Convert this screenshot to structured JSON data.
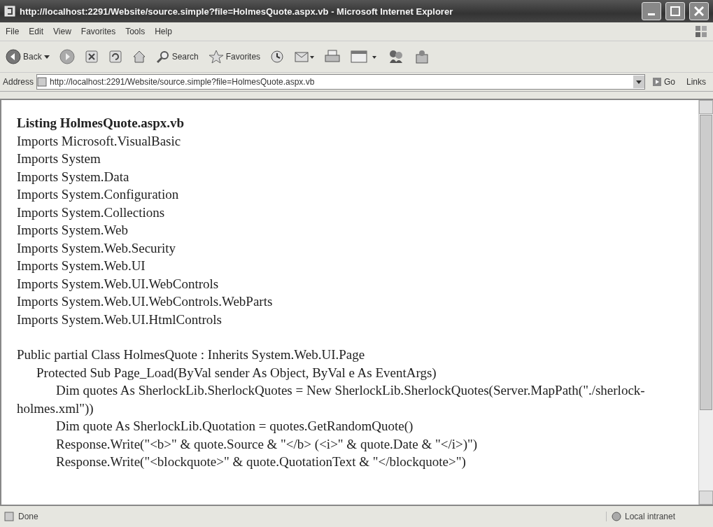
{
  "window": {
    "title": "http://localhost:2291/Website/source.simple?file=HolmesQuote.aspx.vb - Microsoft Internet Explorer"
  },
  "menu": [
    "File",
    "Edit",
    "View",
    "Favorites",
    "Tools",
    "Help"
  ],
  "toolbar": [
    {
      "kind": "back",
      "label": "Back"
    },
    {
      "kind": "forward"
    },
    {
      "kind": "stop"
    },
    {
      "kind": "refresh"
    },
    {
      "kind": "home"
    },
    {
      "kind": "search",
      "label": "Search"
    },
    {
      "kind": "favorites",
      "label": "Favorites"
    },
    {
      "kind": "history"
    },
    {
      "kind": "mail"
    },
    {
      "kind": "print"
    },
    {
      "kind": "edit"
    },
    {
      "kind": "messenger"
    },
    {
      "kind": "research"
    }
  ],
  "address_bar": {
    "label": "Address",
    "value": "http://localhost:2291/Website/source.simple?file=HolmesQuote.aspx.vb",
    "go": "Go",
    "links": "Links"
  },
  "page": {
    "heading": "Listing HolmesQuote.aspx.vb",
    "lines": [
      {
        "text": "Imports Microsoft.VisualBasic"
      },
      {
        "text": "Imports System"
      },
      {
        "text": "Imports System.Data"
      },
      {
        "text": "Imports System.Configuration"
      },
      {
        "text": "Imports System.Collections"
      },
      {
        "text": "Imports System.Web"
      },
      {
        "text": "Imports System.Web.Security"
      },
      {
        "text": "Imports System.Web.UI"
      },
      {
        "text": "Imports System.Web.UI.WebControls"
      },
      {
        "text": "Imports System.Web.UI.WebControls.WebParts"
      },
      {
        "text": "Imports System.Web.UI.HtmlControls"
      },
      {
        "text": "Public partial Class HolmesQuote : Inherits System.Web.UI.Page",
        "children": [
          {
            "text": "Protected Sub Page_Load(ByVal sender As Object, ByVal e As EventArgs)",
            "children": [
              {
                "text": "Dim quotes As SherlockLib.SherlockQuotes = New SherlockLib.SherlockQuotes(Server.MapPath(\"./sherlock-holmes.xml\"))"
              },
              {
                "text": "Dim quote As SherlockLib.Quotation = quotes.GetRandomQuote()"
              },
              {
                "text": "Response.Write(\"<b>\" & quote.Source & \"</b> (<i>\" & quote.Date & \"</i>)\")"
              },
              {
                "text": "Response.Write(\"<blockquote>\" & quote.QuotationText & \"</blockquote>\")"
              }
            ]
          }
        ]
      }
    ]
  },
  "status_bar": {
    "text": "Done",
    "zone": "Local intranet"
  }
}
